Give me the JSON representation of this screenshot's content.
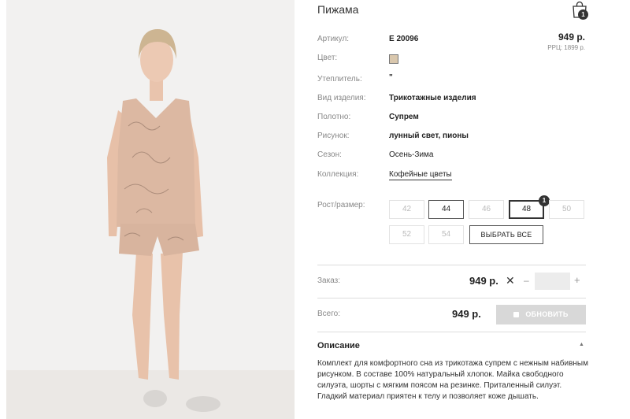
{
  "product": {
    "title": "Пижама",
    "price": "949 р.",
    "rrp": "РРЦ: 1899 р."
  },
  "cart": {
    "icon": "shopping-bag-icon",
    "count": "1"
  },
  "properties": {
    "article": {
      "label": "Артикул:",
      "value": "Е 20096"
    },
    "color": {
      "label": "Цвет:",
      "swatch": "#d9c7ad"
    },
    "insulation": {
      "label": "Утеплитель:",
      "value": "\""
    },
    "type": {
      "label": "Вид изделия:",
      "value": "Трикотажные изделия"
    },
    "fabric": {
      "label": "Полотно:",
      "value": "Супрем"
    },
    "pattern": {
      "label": "Рисунок:",
      "value": "лунный свет, пионы"
    },
    "season": {
      "label": "Сезон:",
      "value": "Осень-Зима"
    },
    "collection": {
      "label": "Коллекция:",
      "value": "Кофейные цветы"
    }
  },
  "sizes": {
    "label": "Рост/размер:",
    "items": [
      {
        "label": "42",
        "state": "unavailable"
      },
      {
        "label": "44",
        "state": "available"
      },
      {
        "label": "46",
        "state": "unavailable"
      },
      {
        "label": "48",
        "state": "selected",
        "badge": "1"
      },
      {
        "label": "50",
        "state": "unavailable"
      },
      {
        "label": "52",
        "state": "unavailable"
      },
      {
        "label": "54",
        "state": "unavailable"
      }
    ],
    "select_all": "ВЫБРАТЬ ВСЕ"
  },
  "order": {
    "label": "Заказ:",
    "price": "949 р.",
    "times": "✕",
    "minus": "–",
    "plus": "+",
    "quantity": ""
  },
  "total": {
    "label": "Всего:",
    "price": "949 р.",
    "button": "ОБНОВИТЬ"
  },
  "description": {
    "title": "Описание",
    "text": "Комплект для комфортного сна из трикотажа супрем с нежным набивным рисунком. В составе 100% натуральный хлопок. Майка свободного силуэта, шорты с мягким поясом на резинке. Приталенный силуэт. Гладкий материал приятен к телу и позволяет коже дышать."
  },
  "colors": {
    "accent": "#333333",
    "muted_label": "#888888",
    "disabled_button": "#d8d8d8",
    "pajama": "#d9b7a3"
  }
}
